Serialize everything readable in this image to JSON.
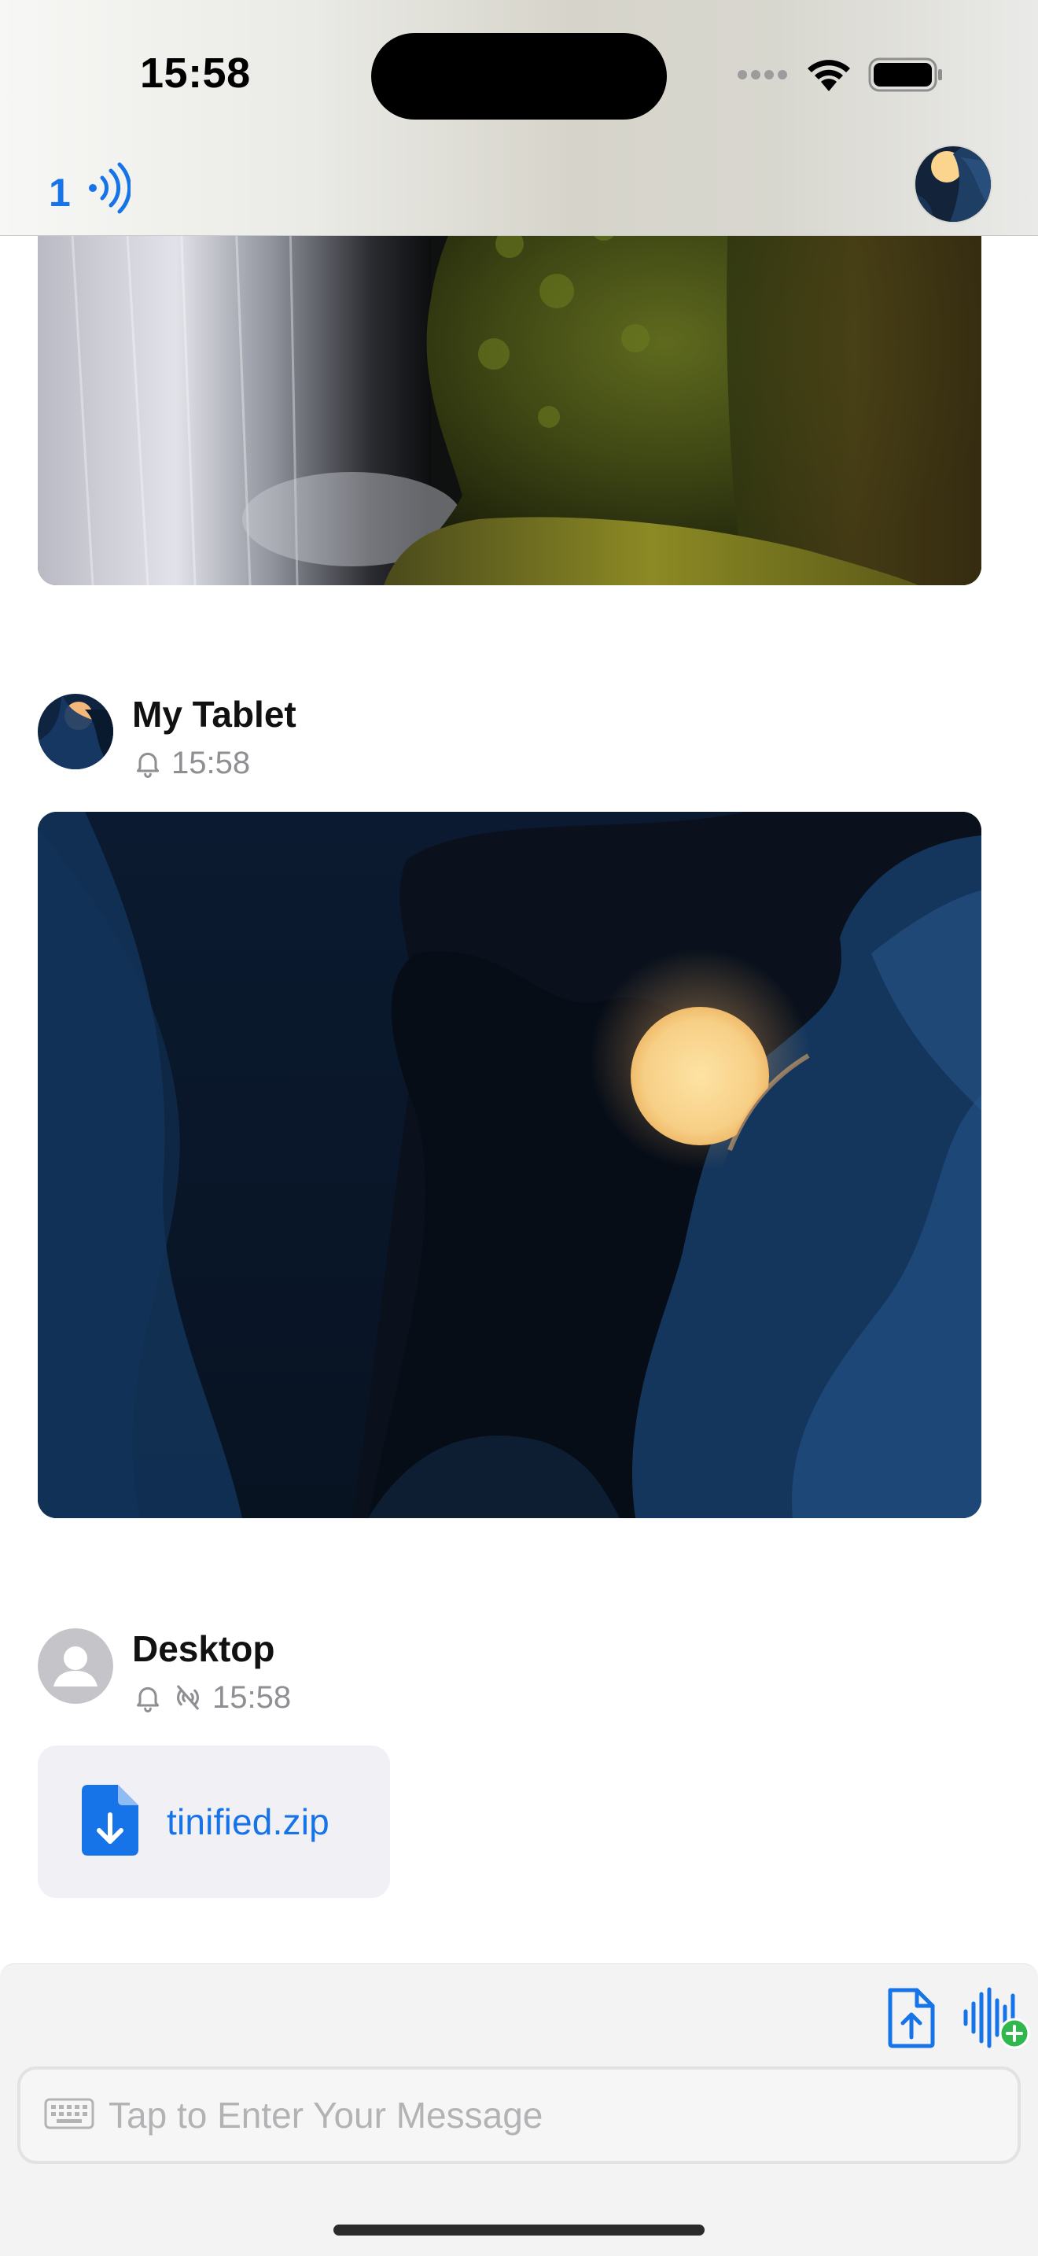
{
  "status_bar": {
    "time": "15:58",
    "icons": [
      "cellular-dots-icon",
      "wifi-icon",
      "battery-icon"
    ]
  },
  "header": {
    "connected_count": "1",
    "broadcast_icon": "broadcast-icon",
    "avatar": "moon-avatar"
  },
  "messages": [
    {
      "type": "image",
      "description_icon": "image"
    },
    {
      "sender": "My Tablet",
      "time": "15:58",
      "icons": [
        "bell-icon"
      ],
      "type": "image"
    },
    {
      "sender": "Desktop",
      "time": "15:58",
      "icons": [
        "bell-icon",
        "offline-broadcast-icon"
      ],
      "type": "file",
      "file_name": "tinified.zip"
    }
  ],
  "composer": {
    "placeholder": "Tap to Enter Your Message",
    "actions": [
      "upload-file-icon",
      "voice-message-add-icon"
    ]
  },
  "colors": {
    "accent": "#1773e8",
    "secondary_text": "#8e8e93",
    "file_bubble_bg": "#f0f0f5",
    "composer_bg": "#f3f3f3"
  }
}
